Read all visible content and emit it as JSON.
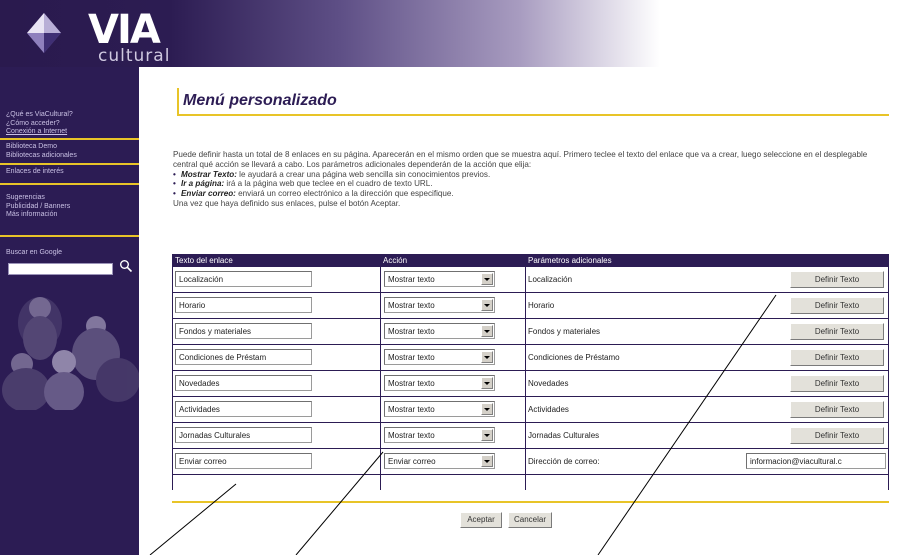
{
  "logo": {
    "wordmark": "VIA",
    "subtitle": "cultural"
  },
  "sidebar": {
    "groups": [
      [
        "¿Qué es ViaCultural?",
        "¿Cómo acceder?",
        "Conexión a Internet"
      ],
      [
        "Biblioteca Demo",
        "Bibliotecas adicionales"
      ],
      [
        "Enlaces de interés"
      ],
      [
        "Sugerencias",
        "Publicidad / Banners",
        "Más información"
      ],
      [
        "Buscar en Google"
      ]
    ]
  },
  "main": {
    "title": "Menú personalizado",
    "intro": "Puede definir hasta un total de 8 enlaces en su página. Aparecerán en el mismo orden que se muestra aquí. Primero teclee el texto del enlace que va a crear, luego seleccione en el desplegable central qué acción se llevará a cabo. Los parámetros adicionales dependerán de la acción que elija:",
    "bullets": [
      {
        "term": "Mostrar Texto:",
        "text": " le ayudará a crear una página web sencilla sin conocimientos previos."
      },
      {
        "term": "Ir a página:",
        "text": " irá a la página web que teclee en el cuadro de texto URL."
      },
      {
        "term": "Enviar correo:",
        "text": " enviará un correo electrónico a la dirección que especifique."
      }
    ],
    "outro": "Una vez que haya definido sus enlaces, pulse el botón Aceptar."
  },
  "table": {
    "headers": [
      "Texto del enlace",
      "Acción",
      "Parámetros adicionales"
    ],
    "define_label": "Definir Texto",
    "rows": [
      {
        "text": "Localización",
        "action": "Mostrar texto",
        "param": "Localización"
      },
      {
        "text": "Horario",
        "action": "Mostrar texto",
        "param": "Horario"
      },
      {
        "text": "Fondos y materiales",
        "action": "Mostrar texto",
        "param": "Fondos y materiales"
      },
      {
        "text": "Condiciones de Préstam",
        "action": "Mostrar texto",
        "param": "Condiciones de Préstamo"
      },
      {
        "text": "Novedades",
        "action": "Mostrar texto",
        "param": "Novedades"
      },
      {
        "text": "Actividades",
        "action": "Mostrar texto",
        "param": "Actividades"
      },
      {
        "text": "Jornadas Culturales",
        "action": "Mostrar texto",
        "param": "Jornadas Culturales"
      },
      {
        "text": "Enviar correo",
        "action": "Enviar correo",
        "param": "Dirección de correo:",
        "email": "informacion@viacultural.c"
      }
    ]
  },
  "buttons": {
    "accept": "Aceptar",
    "cancel": "Cancelar"
  },
  "colors": {
    "accent": "#e8c428",
    "brand": "#2c1c54"
  }
}
